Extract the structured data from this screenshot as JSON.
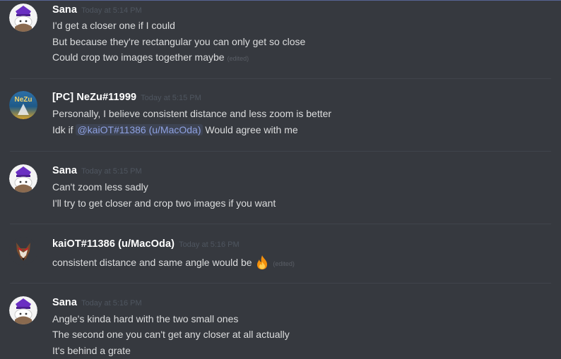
{
  "messages": [
    {
      "author": "Sana",
      "avatar_icon": "sana-avatar-icon",
      "timestamp": "Today at 5:14 PM",
      "lines": [
        {
          "text": "I'd get a closer one if I could"
        },
        {
          "text": "But because they're rectangular you can only get so close"
        },
        {
          "text": "Could crop two images together maybe",
          "edited": "(edited)"
        }
      ]
    },
    {
      "author": "[PC] NeZu#11999",
      "avatar_icon": "nezu-avatar-icon",
      "avatar_text": "NeZu",
      "timestamp": "Today at 5:15 PM",
      "lines": [
        {
          "text": "Personally, I believe consistent distance and less zoom is better"
        },
        {
          "prefix": "Idk if ",
          "mention": "@kaiOT#11386 (u/MacOda)",
          "suffix": " Would agree with me"
        }
      ]
    },
    {
      "author": "Sana",
      "avatar_icon": "sana-avatar-icon",
      "timestamp": "Today at 5:15 PM",
      "lines": [
        {
          "text": "Can't zoom less sadly"
        },
        {
          "text": "I'll try to get closer and crop two images if you want"
        }
      ]
    },
    {
      "author": "kaiOT#11386 (u/MacOda)",
      "avatar_icon": "coyote-avatar-icon",
      "timestamp": "Today at 5:16 PM",
      "lines": [
        {
          "text": "consistent distance and same angle would be ",
          "emoji": "fire-emoji-icon",
          "edited": "(edited)"
        }
      ]
    },
    {
      "author": "Sana",
      "avatar_icon": "sana-avatar-icon",
      "timestamp": "Today at 5:16 PM",
      "lines": [
        {
          "text": "Angle's kinda hard with the two small ones"
        },
        {
          "text": "The second one you can't get any closer at all actually"
        },
        {
          "text": "It's behind a grate"
        }
      ]
    }
  ],
  "colors": {
    "background": "#36393f",
    "username": "#ffffff",
    "message_text": "#dcddde",
    "timestamp": "#4f5660",
    "mention": "#8ea1e1",
    "divider": "#40444b"
  }
}
